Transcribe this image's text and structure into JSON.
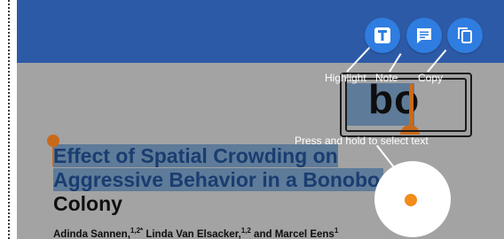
{
  "toolbar": {
    "actions": [
      {
        "label": "Highlight",
        "icon": "text-highlight-icon"
      },
      {
        "label": "Note",
        "icon": "note-icon"
      },
      {
        "label": "Copy",
        "icon": "copy-icon"
      }
    ]
  },
  "magnifier": {
    "text": "bo"
  },
  "hint": "Press and hold to select text",
  "article": {
    "title_line1": "Effect of Spatial Crowding on",
    "title_line2": "Aggressive Behavior in a Bonobo",
    "title_line3": "Colony",
    "authors": [
      {
        "name": "Adinda Sannen,",
        "sup": "1,2*"
      },
      {
        "name": " Linda Van Elsacker,",
        "sup": "1,2"
      },
      {
        "name": " and Marcel Eens",
        "sup": "1"
      }
    ]
  },
  "colors": {
    "topbar": "#2d5aa7",
    "button": "#2f7de0",
    "selection": "#5e7b99",
    "handle": "#c96a1a",
    "touch_dot": "#f28c1a"
  }
}
